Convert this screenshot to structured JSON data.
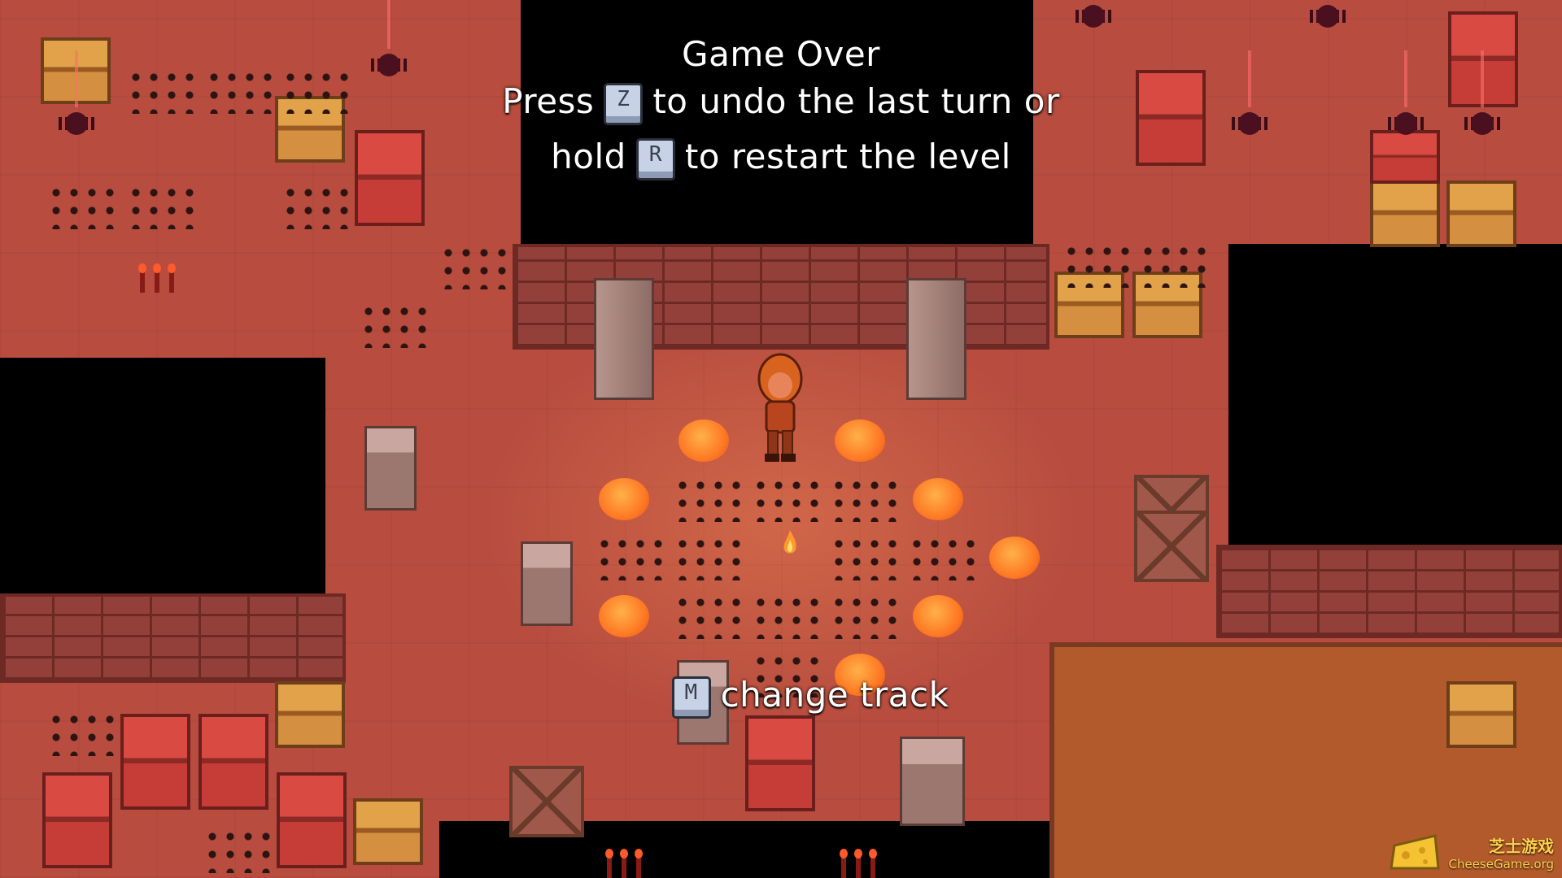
{
  "game_over": {
    "title": "Game Over",
    "line1_before": "Press",
    "undo_key": "Z",
    "line1_after": "to undo the last turn or",
    "line2_before": "hold",
    "restart_key": "R",
    "line2_after": "to restart the level"
  },
  "music_hint": {
    "key": "M",
    "label": "change track"
  },
  "watermark": {
    "title": "芝士游戏",
    "site": "CheeseGame.org"
  },
  "colors": {
    "floor": "#b84d3f",
    "pit": "#000000",
    "lava": "#ff7a24",
    "text": "#ffffff"
  }
}
